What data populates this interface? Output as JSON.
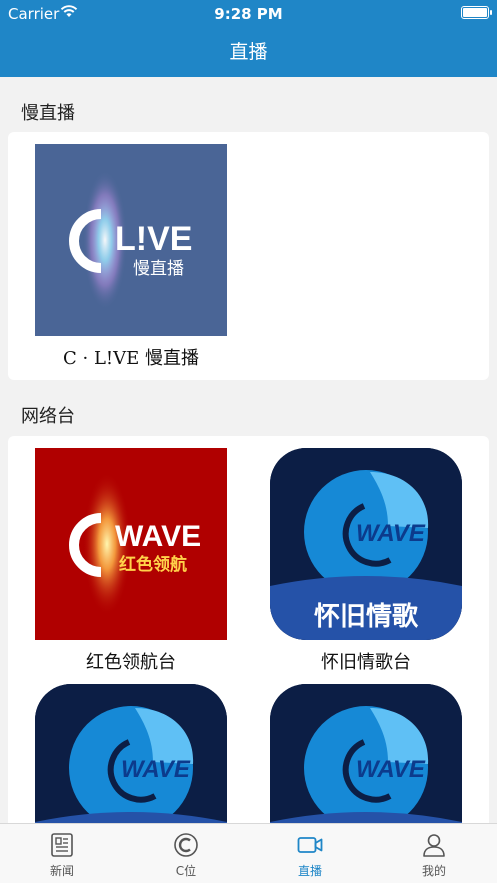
{
  "status_bar": {
    "carrier": "Carrier",
    "time": "9:28 PM"
  },
  "header": {
    "title": "直播"
  },
  "sections": [
    {
      "title": "慢直播",
      "items": [
        {
          "caption": "C · L!VE 慢直播",
          "logo_main": "L!VE",
          "logo_sub": "慢直播",
          "bg": "#4a6596"
        }
      ]
    },
    {
      "title": "网络台",
      "items": [
        {
          "caption": "红色领航台",
          "logo_main": "WAVE",
          "logo_sub": "红色领航",
          "bg": "#b00000"
        },
        {
          "caption": "怀旧情歌台",
          "logo_main": "WAVE",
          "logo_sub": "怀旧情歌",
          "bg": "#0c1e45"
        },
        {
          "caption": "",
          "logo_main": "WAVE",
          "bg": "#0c1e45"
        },
        {
          "caption": "",
          "logo_main": "WAVE",
          "bg": "#0c1e45"
        }
      ]
    }
  ],
  "tabbar": {
    "active_color": "#1f86c7",
    "items": [
      {
        "label": "新闻",
        "icon": "newspaper-icon"
      },
      {
        "label": "C位",
        "icon": "c-position-icon"
      },
      {
        "label": "直播",
        "icon": "video-camera-icon",
        "active": true
      },
      {
        "label": "我的",
        "icon": "user-icon"
      }
    ]
  }
}
